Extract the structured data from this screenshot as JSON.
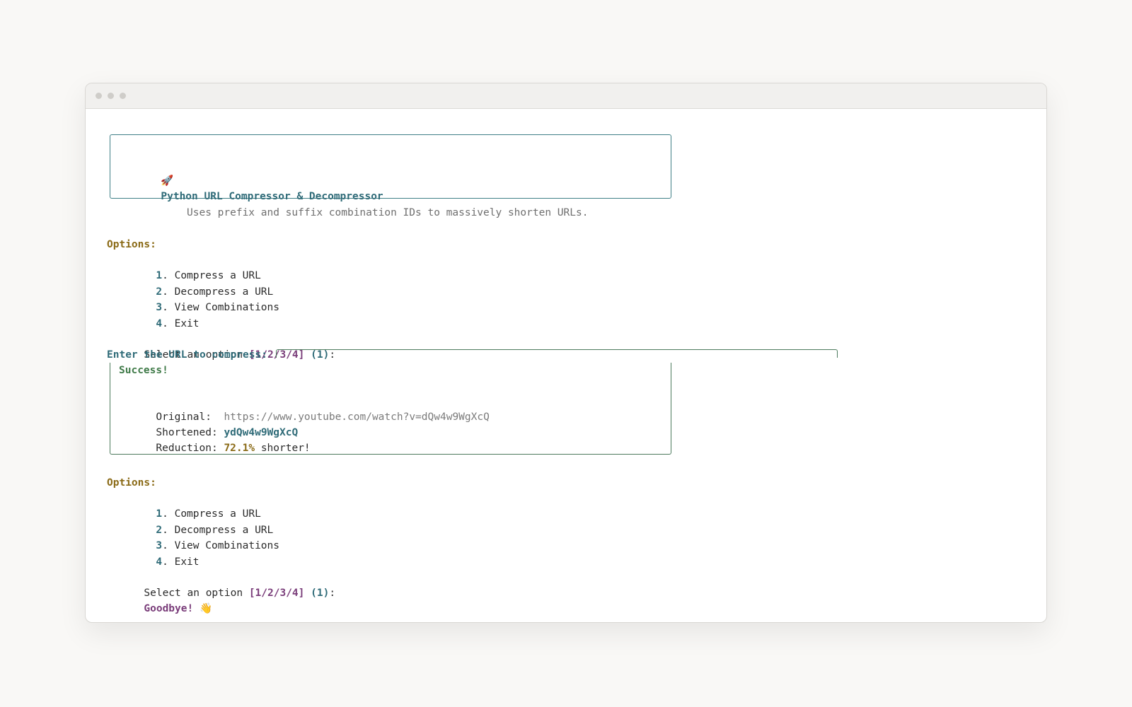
{
  "header": {
    "icon": "🚀",
    "title": "Python URL Compressor & Decompressor",
    "subtitle": "Uses prefix and suffix combination IDs to massively shorten URLs."
  },
  "menu": {
    "heading": "Options:",
    "items": [
      {
        "num": "1",
        "label": "Compress a URL"
      },
      {
        "num": "2",
        "label": "Decompress a URL"
      },
      {
        "num": "3",
        "label": "View Combinations"
      },
      {
        "num": "4",
        "label": "Exit"
      }
    ]
  },
  "prompt": {
    "text": "Select an option",
    "choices": "[1/2/3/4]",
    "default": "(1)",
    "colon": ":"
  },
  "compress_prompt": "Enter the URL to compress:",
  "result": {
    "status": "Success!",
    "original_label": "Original:",
    "original_value": "https://www.youtube.com/watch?v=dQw4w9WgXcQ",
    "shortened_label": "Shortened:",
    "shortened_value": "ydQw4w9WgXcQ",
    "reduction_label": "Reduction:",
    "reduction_value": "72.1%",
    "reduction_suffix": "shorter!"
  },
  "farewell": {
    "text": "Goodbye!",
    "icon": "👋"
  },
  "colors": {
    "title": "#2f6b78",
    "options_heading": "#8a6a16",
    "choices": "#7a3d7a",
    "success": "#3f7a48"
  }
}
